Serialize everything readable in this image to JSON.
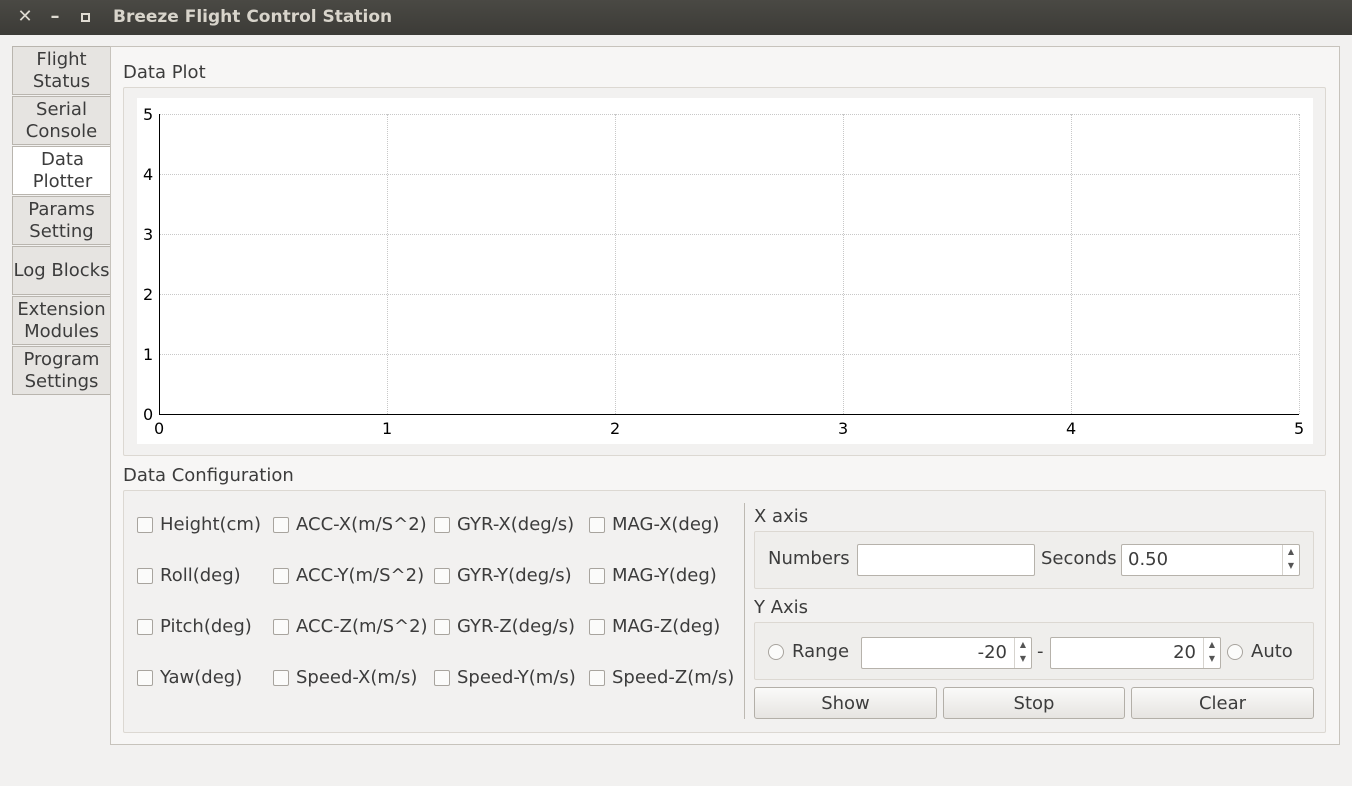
{
  "window": {
    "title": "Breeze Flight Control Station"
  },
  "tabs": [
    {
      "l1": "Flight",
      "l2": "Status"
    },
    {
      "l1": "Serial",
      "l2": "Console"
    },
    {
      "l1": "Data",
      "l2": "Plotter"
    },
    {
      "l1": "Params",
      "l2": "Setting"
    },
    {
      "l1": "Log Blocks",
      "l2": ""
    },
    {
      "l1": "Extension",
      "l2": "Modules"
    },
    {
      "l1": "Program",
      "l2": "Settings"
    }
  ],
  "plot": {
    "title": "Data Plot",
    "x_ticks": [
      "0",
      "1",
      "2",
      "3",
      "4",
      "5"
    ],
    "y_ticks": [
      "0",
      "1",
      "2",
      "3",
      "4",
      "5"
    ]
  },
  "config": {
    "title": "Data Configuration",
    "checks": [
      [
        "Height(cm)",
        "ACC-X(m/S^2)",
        "GYR-X(deg/s)",
        "MAG-X(deg)"
      ],
      [
        "Roll(deg)",
        "ACC-Y(m/S^2)",
        "GYR-Y(deg/s)",
        "MAG-Y(deg)"
      ],
      [
        "Pitch(deg)",
        "ACC-Z(m/S^2)",
        "GYR-Z(deg/s)",
        "MAG-Z(deg)"
      ],
      [
        "Yaw(deg)",
        "Speed-X(m/s)",
        "Speed-Y(m/s)",
        "Speed-Z(m/s)"
      ]
    ],
    "xaxis": {
      "title": "X axis",
      "numbers_label": "Numbers",
      "numbers_value": "",
      "seconds_label": "Seconds",
      "seconds_value": "0.50"
    },
    "yaxis": {
      "title": "Y Axis",
      "range_label": "Range",
      "min": "-20",
      "dash": "-",
      "max": "20",
      "auto_label": "Auto"
    },
    "buttons": {
      "show": "Show",
      "stop": "Stop",
      "clear": "Clear"
    }
  }
}
